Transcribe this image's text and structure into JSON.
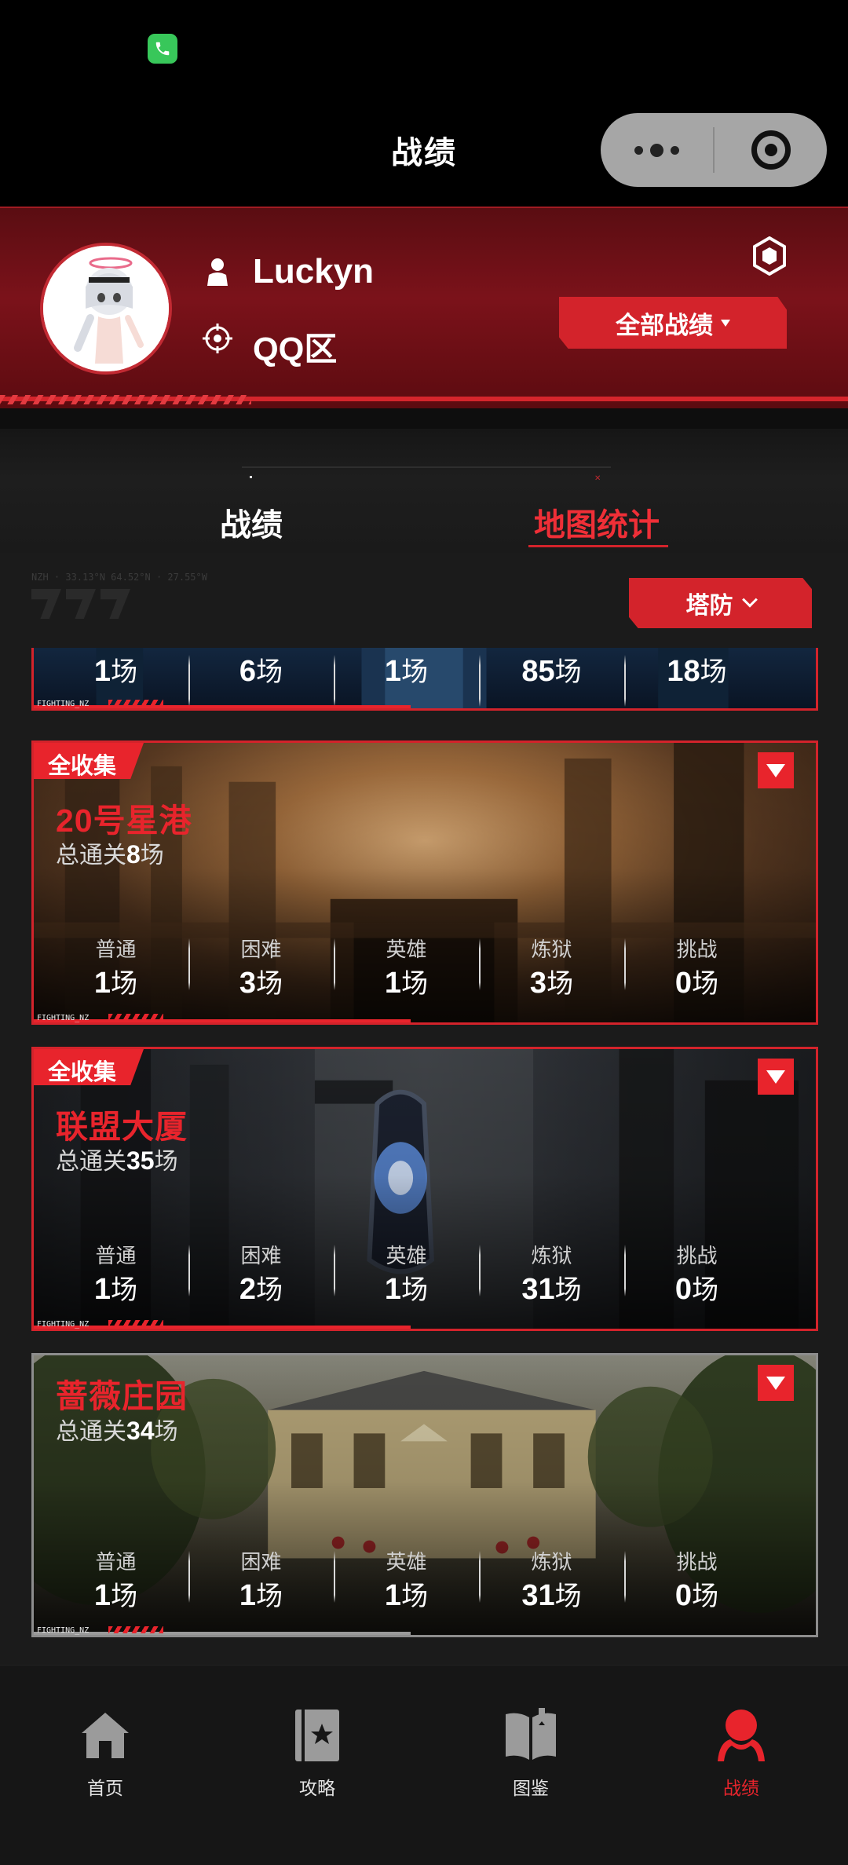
{
  "status_bar": {
    "icons": [
      "phone-icon"
    ]
  },
  "title_bar": {
    "title": "战绩",
    "capsule": {
      "more_icon": "more-dots-icon",
      "close_icon": "target-close-icon"
    }
  },
  "profile": {
    "username": "Luckyn",
    "region": "QQ区",
    "all_records_label": "全部战绩",
    "icons": {
      "user": "user-icon",
      "region": "crosshair-icon",
      "settings": "hexagon-settings-icon"
    }
  },
  "tabs": [
    {
      "label": "战绩",
      "active": false
    },
    {
      "label": "地图统计",
      "active": true
    }
  ],
  "filter": {
    "mode_label": "塔防",
    "deco_text": "NZH · 33.13°N 64.52°N · 27.55°W"
  },
  "partial_card": {
    "stats": [
      {
        "value": "1",
        "unit": "场"
      },
      {
        "value": "6",
        "unit": "场"
      },
      {
        "value": "1",
        "unit": "场"
      },
      {
        "value": "85",
        "unit": "场"
      },
      {
        "value": "18",
        "unit": "场"
      }
    ],
    "footer_text": "FIGHTING_NZ"
  },
  "maps": [
    {
      "badge": "全收集",
      "name": "20号星港",
      "clear_prefix": "总通关",
      "clear_count": "8",
      "clear_unit": "场",
      "footer_text": "FIGHTING_NZ",
      "stats": [
        {
          "label": "普通",
          "value": "1",
          "unit": "场"
        },
        {
          "label": "困难",
          "value": "3",
          "unit": "场"
        },
        {
          "label": "英雄",
          "value": "1",
          "unit": "场"
        },
        {
          "label": "炼狱",
          "value": "3",
          "unit": "场"
        },
        {
          "label": "挑战",
          "value": "0",
          "unit": "场"
        }
      ]
    },
    {
      "badge": "全收集",
      "name": "联盟大厦",
      "clear_prefix": "总通关",
      "clear_count": "35",
      "clear_unit": "场",
      "footer_text": "FIGHTING_NZ",
      "stats": [
        {
          "label": "普通",
          "value": "1",
          "unit": "场"
        },
        {
          "label": "困难",
          "value": "2",
          "unit": "场"
        },
        {
          "label": "英雄",
          "value": "1",
          "unit": "场"
        },
        {
          "label": "炼狱",
          "value": "31",
          "unit": "场"
        },
        {
          "label": "挑战",
          "value": "0",
          "unit": "场"
        }
      ]
    },
    {
      "badge": "",
      "name": "蔷薇庄园",
      "clear_prefix": "总通关",
      "clear_count": "34",
      "clear_unit": "场",
      "footer_text": "FIGHTING_NZ",
      "stats": [
        {
          "label": "普通",
          "value": "1",
          "unit": "场"
        },
        {
          "label": "困难",
          "value": "1",
          "unit": "场"
        },
        {
          "label": "英雄",
          "value": "1",
          "unit": "场"
        },
        {
          "label": "炼狱",
          "value": "31",
          "unit": "场"
        },
        {
          "label": "挑战",
          "value": "0",
          "unit": "场"
        }
      ]
    }
  ],
  "bottom_nav": [
    {
      "label": "首页",
      "icon": "home-icon",
      "active": false
    },
    {
      "label": "攻略",
      "icon": "guide-book-icon",
      "active": false
    },
    {
      "label": "图鉴",
      "icon": "open-book-icon",
      "active": false
    },
    {
      "label": "战绩",
      "icon": "profile-icon",
      "active": true
    }
  ],
  "colors": {
    "accent": "#e8242c",
    "header_red": "#7b121a",
    "background": "#141414"
  }
}
